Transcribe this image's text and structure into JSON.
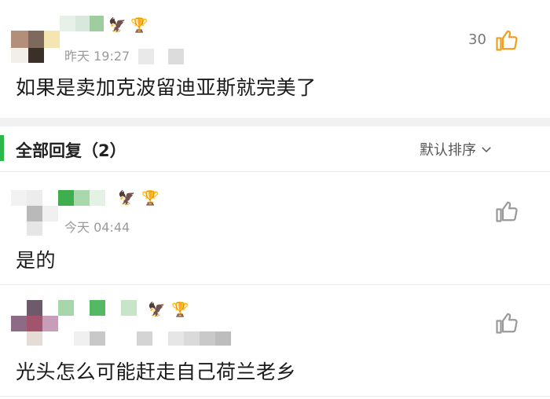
{
  "main_comment": {
    "timestamp": "昨天 19:27",
    "text": "如果是卖加克波留迪亚斯就完美了",
    "like_count": "30"
  },
  "replies_header": {
    "title": "全部回复（2）",
    "sort_label": "默认排序"
  },
  "replies": [
    {
      "timestamp": "今天 04:44",
      "text": "是的"
    },
    {
      "timestamp": "",
      "text": "光头怎么可能赶走自己荷兰老乡"
    }
  ],
  "colors": {
    "accent_green": "#2db84c",
    "like_active": "#f0a020",
    "like_inactive": "#9a9a9a"
  },
  "icons": {
    "like": "thumbs-up-icon",
    "sort": "chevron-down-icon",
    "badge1": "liverpool-crest-icon",
    "badge2": "trophy-icon"
  }
}
